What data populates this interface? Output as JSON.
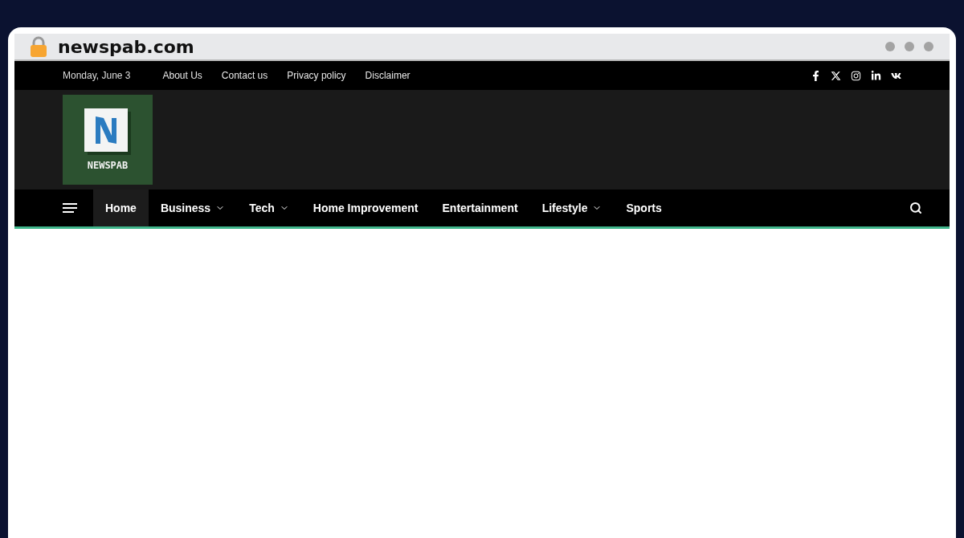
{
  "browser": {
    "url": "newspab.com"
  },
  "top_bar": {
    "date": "Monday, June 3",
    "links": [
      "About Us",
      "Contact us",
      "Privacy policy",
      "Disclaimer"
    ]
  },
  "logo": {
    "text": "NEWSPAB"
  },
  "nav": {
    "items": [
      {
        "label": "Home",
        "selected": true,
        "dropdown": false
      },
      {
        "label": "Business",
        "selected": false,
        "dropdown": true
      },
      {
        "label": "Tech",
        "selected": false,
        "dropdown": true
      },
      {
        "label": "Home Improvement",
        "selected": false,
        "dropdown": false
      },
      {
        "label": "Entertainment",
        "selected": false,
        "dropdown": false
      },
      {
        "label": "Lifestyle",
        "selected": false,
        "dropdown": true
      },
      {
        "label": "Sports",
        "selected": false,
        "dropdown": false
      }
    ]
  }
}
